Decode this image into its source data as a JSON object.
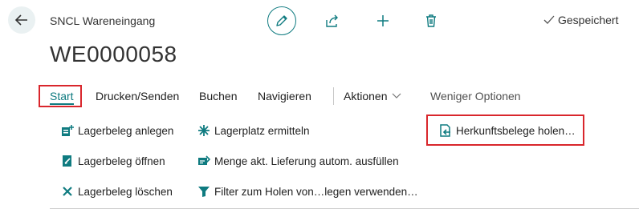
{
  "header": {
    "page_caption": "SNCL Wareneingang",
    "document_no": "WE0000058",
    "saved_status": "Gespeichert"
  },
  "icons": {
    "back": "arrow-left-icon",
    "edit": "pencil-icon",
    "share": "share-icon",
    "add": "plus-icon",
    "delete": "trash-icon",
    "saved": "check-icon"
  },
  "colors": {
    "accent": "#0f7b80",
    "highlight_border": "#d9262c",
    "back_button_bg": "#eaf1f2"
  },
  "menu": {
    "start": "Start",
    "print_send": "Drucken/Senden",
    "post": "Buchen",
    "navigate": "Navigieren",
    "actions": "Aktionen",
    "fewer_options": "Weniger Optionen"
  },
  "actions": {
    "col1": [
      {
        "label": "Lagerbeleg anlegen",
        "icon": "create-document-icon"
      },
      {
        "label": "Lagerbeleg öffnen",
        "icon": "open-document-icon"
      },
      {
        "label": "Lagerbeleg löschen",
        "icon": "delete-x-icon"
      }
    ],
    "col2": [
      {
        "label": "Lagerplatz ermitteln",
        "icon": "calculate-bin-icon"
      },
      {
        "label": "Menge akt. Lieferung autom. ausfüllen",
        "icon": "autofill-qty-icon"
      },
      {
        "label": "Filter zum Holen von…legen verwenden…",
        "icon": "filter-icon"
      }
    ],
    "col3": [
      {
        "label": "Herkunftsbelege holen…",
        "icon": "get-source-documents-icon"
      }
    ]
  }
}
